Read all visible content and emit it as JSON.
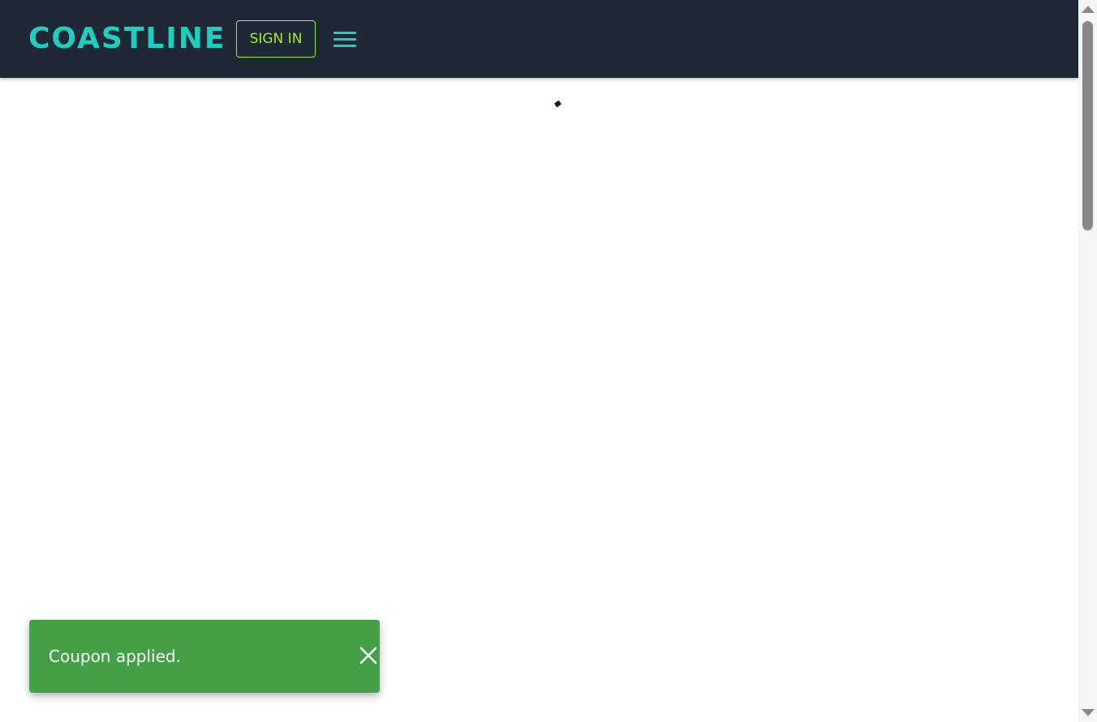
{
  "header": {
    "logo_text": "COASTLINE",
    "signin_label": "SIGN IN",
    "menu_icon": "hamburger-menu-icon"
  },
  "toast": {
    "message": "Coupon applied.",
    "close_icon": "close-icon"
  },
  "colors": {
    "header_bg": "#1f2835",
    "logo": "#1ecfbf",
    "signin_text": "#a3e635",
    "signin_border": "#a3e635",
    "menu_icon": "#1ecfbf",
    "toast_bg": "#43a047",
    "toast_text": "#ffffff"
  }
}
